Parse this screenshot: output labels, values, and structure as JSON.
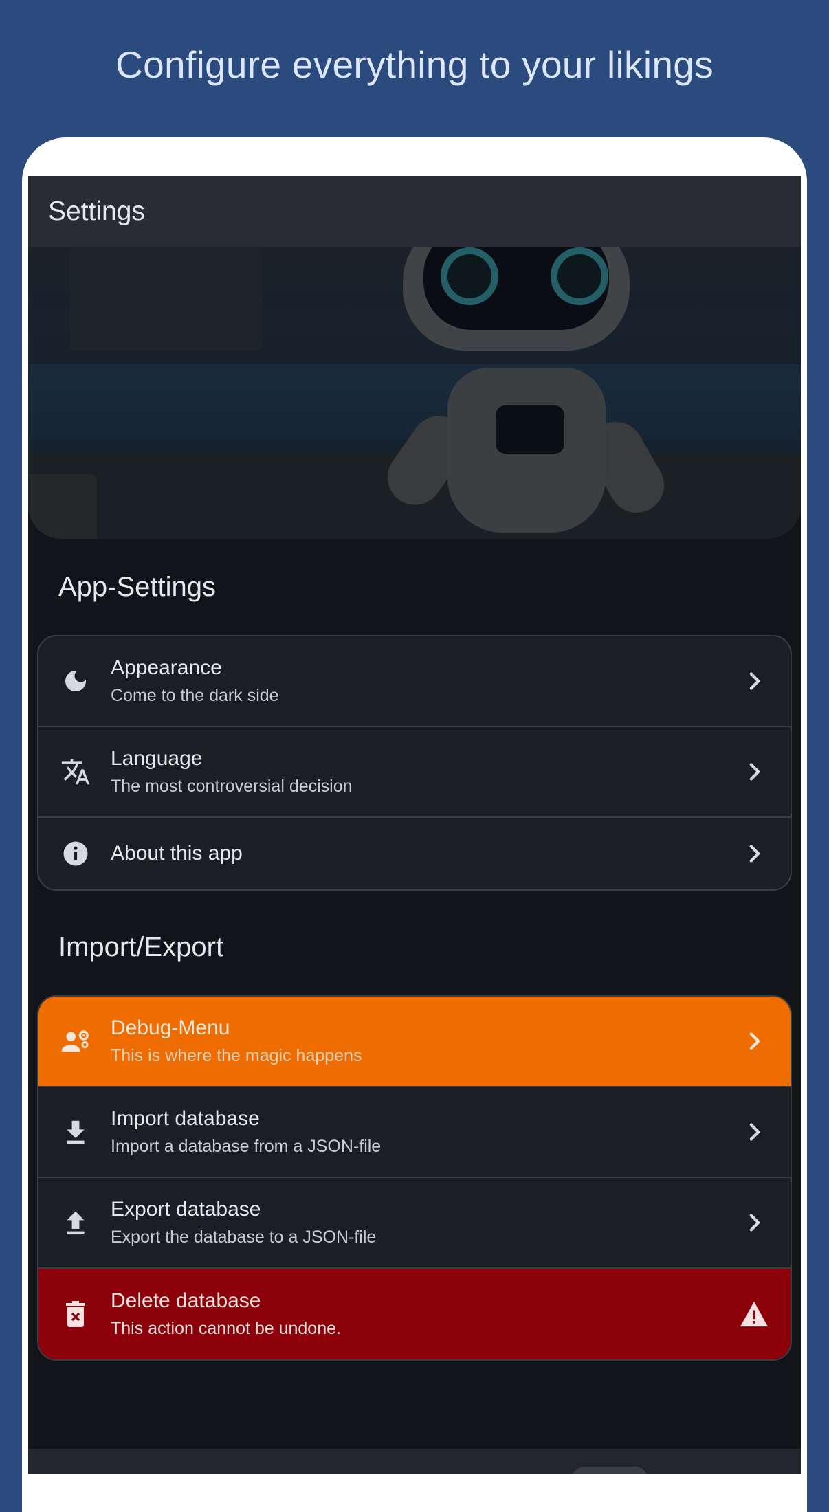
{
  "promo": {
    "heading": "Configure everything to your likings"
  },
  "appbar": {
    "title": "Settings"
  },
  "hero": {
    "image": "robot-illustration"
  },
  "sections": {
    "app_settings": {
      "title": "App-Settings",
      "items": [
        {
          "label": "Appearance",
          "sub": "Come to the dark side",
          "icon": "moon-icon"
        },
        {
          "label": "Language",
          "sub": "The most controversial decision",
          "icon": "translate-icon"
        },
        {
          "label": "About this app",
          "sub": "",
          "icon": "info-icon"
        }
      ]
    },
    "import_export": {
      "title": "Import/Export",
      "items": [
        {
          "label": "Debug-Menu",
          "sub": "This is where the magic happens",
          "icon": "engineer-icon",
          "accent": "#ee6c00"
        },
        {
          "label": "Import database",
          "sub": "Import a database from a JSON-file",
          "icon": "download-icon"
        },
        {
          "label": "Export database",
          "sub": "Export the database to a JSON-file",
          "icon": "upload-icon"
        },
        {
          "label": "Delete database",
          "sub": "This action cannot be undone.",
          "icon": "trash-icon",
          "trailing_icon": "warning-icon",
          "accent": "#8b0009"
        }
      ]
    }
  },
  "colors": {
    "background": "#2b4a7d",
    "screen": "#121419",
    "card": "#1c1e23",
    "debug_accent": "#ee6c00",
    "danger_accent": "#8b0009"
  }
}
